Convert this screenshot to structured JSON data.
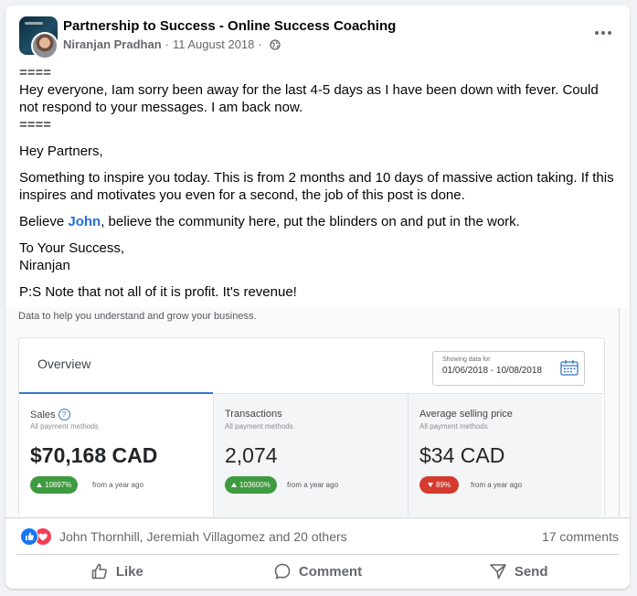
{
  "post": {
    "group_name": "Partnership to Success - Online Success Coaching",
    "author": "Niranjan Pradhan",
    "separator": "·",
    "date": "11 August 2018",
    "body": {
      "line1": "====",
      "line2": "Hey everyone, Iam sorry been away for the last 4-5 days as I have been down with fever. Could not respond to your messages. I am back now.",
      "line3": "====",
      "greeting": "Hey Partners,",
      "para1": "Something to inspire you today. This is from 2 months and 10 days of massive action taking. If this inspires and motivates you even for a second, the job of this post is done.",
      "believe_prefix": "Believe ",
      "believe_mention": "John",
      "believe_suffix": ", believe the community here, put the blinders on and put in the work.",
      "signoff1": "To Your Success,",
      "signoff2": "Niranjan",
      "ps": "P:S Note that not all of it is profit. It's revenue!"
    }
  },
  "screenshot": {
    "intro": "Data to help you understand and grow your business.",
    "overview_title": "Overview",
    "range_label": "Showing data for",
    "range_value": "01/06/2018 - 10/08/2018",
    "metrics": [
      {
        "title": "Sales",
        "sub": "All payment methods",
        "value": "$70,168 CAD",
        "change": "10897%",
        "since": "from a year ago"
      },
      {
        "title": "Transactions",
        "sub": "All payment methods",
        "value": "2,074",
        "change": "103600%",
        "since": "from a year ago"
      },
      {
        "title": "Average selling price",
        "sub": "All payment methods",
        "value": "$34 CAD",
        "change": "89%",
        "since": "from a year ago"
      }
    ],
    "help_glyph": "?"
  },
  "reactions": {
    "names": "John Thornhill, Jeremiah Villagomez and 20 others",
    "comments": "17 comments"
  },
  "actions": {
    "like": "Like",
    "comment": "Comment",
    "send": "Send"
  },
  "colors": {
    "mention": "#216fdb",
    "like_blue": "#1877f2",
    "love_red": "#f33e58",
    "up_green": "#3f9b3f",
    "down_red": "#d63a2f"
  }
}
